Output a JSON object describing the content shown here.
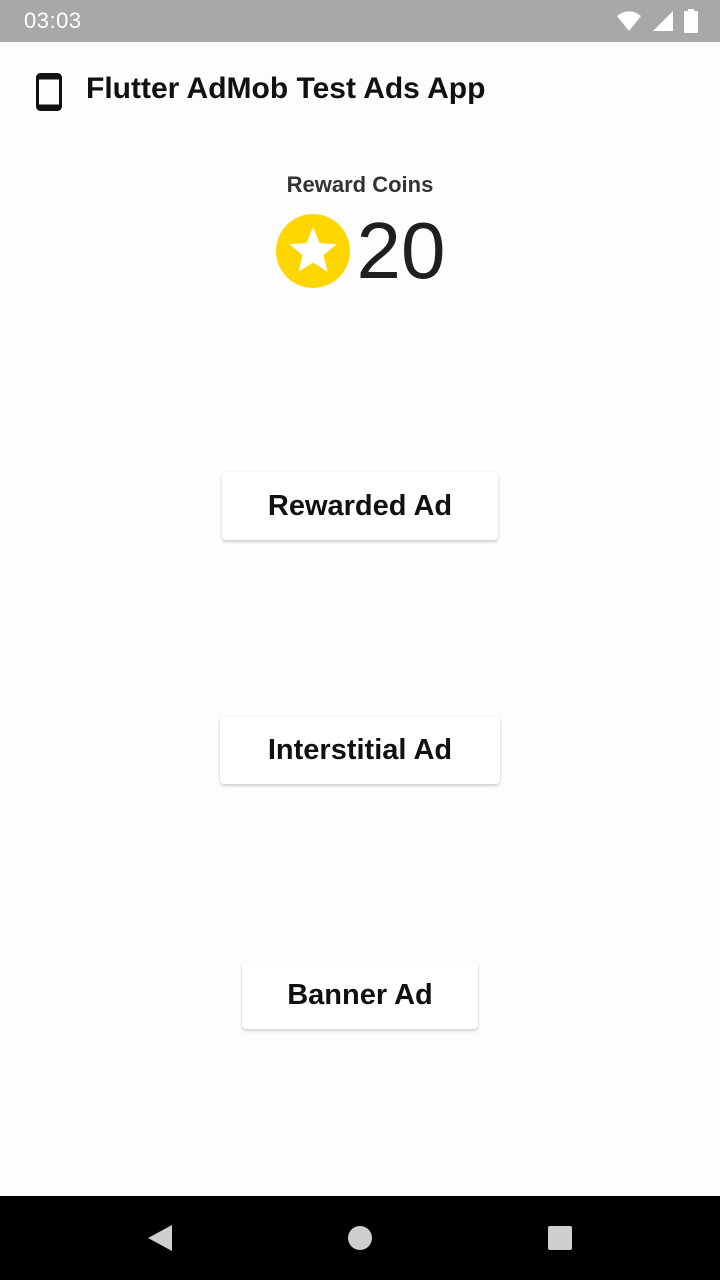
{
  "status_bar": {
    "time": "03:03",
    "icons": [
      "wifi-icon",
      "signal-icon",
      "battery-icon"
    ]
  },
  "app_bar": {
    "icon": "phone-icon",
    "title": "Flutter AdMob Test Ads App"
  },
  "reward": {
    "label": "Reward Coins",
    "icon": "star-coin-icon",
    "count": "20",
    "coin_color": "#FFD600"
  },
  "buttons": {
    "rewarded": "Rewarded Ad",
    "interstitial": "Interstitial Ad",
    "banner": "Banner Ad"
  },
  "nav_bar": {
    "back": "back-icon",
    "home": "home-icon",
    "recent": "recent-apps-icon"
  }
}
